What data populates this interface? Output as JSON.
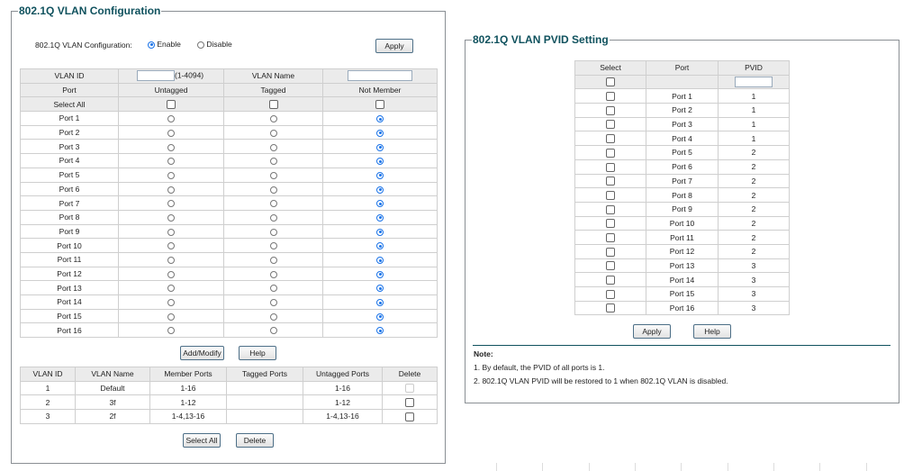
{
  "vlan_config": {
    "title": "802.1Q VLAN Configuration",
    "mode_label": "802.1Q VLAN Configuration:",
    "enable_label": "Enable",
    "disable_label": "Disable",
    "mode": "Enable",
    "apply_label": "Apply",
    "vlan_id_label": "VLAN ID",
    "vlan_id_value": "",
    "vlan_id_range": "(1-4094)",
    "vlan_name_label": "VLAN Name",
    "vlan_name_value": "",
    "columns": [
      "Port",
      "Untagged",
      "Tagged",
      "Not Member"
    ],
    "select_all_label": "Select All",
    "ports": [
      {
        "name": "Port 1",
        "membership": "Not Member"
      },
      {
        "name": "Port 2",
        "membership": "Not Member"
      },
      {
        "name": "Port 3",
        "membership": "Not Member"
      },
      {
        "name": "Port 4",
        "membership": "Not Member"
      },
      {
        "name": "Port 5",
        "membership": "Not Member"
      },
      {
        "name": "Port 6",
        "membership": "Not Member"
      },
      {
        "name": "Port 7",
        "membership": "Not Member"
      },
      {
        "name": "Port 8",
        "membership": "Not Member"
      },
      {
        "name": "Port 9",
        "membership": "Not Member"
      },
      {
        "name": "Port 10",
        "membership": "Not Member"
      },
      {
        "name": "Port 11",
        "membership": "Not Member"
      },
      {
        "name": "Port 12",
        "membership": "Not Member"
      },
      {
        "name": "Port 13",
        "membership": "Not Member"
      },
      {
        "name": "Port 14",
        "membership": "Not Member"
      },
      {
        "name": "Port 15",
        "membership": "Not Member"
      },
      {
        "name": "Port 16",
        "membership": "Not Member"
      }
    ],
    "add_modify_label": "Add/Modify",
    "help_label": "Help",
    "list_columns": [
      "VLAN ID",
      "VLAN Name",
      "Member Ports",
      "Tagged Ports",
      "Untagged Ports",
      "Delete"
    ],
    "vlans": [
      {
        "id": "1",
        "name": "Default",
        "member": "1-16",
        "tagged": "",
        "untagged": "1-16",
        "deletable": false
      },
      {
        "id": "2",
        "name": "3f",
        "member": "1-12",
        "tagged": "",
        "untagged": "1-12",
        "deletable": true
      },
      {
        "id": "3",
        "name": "2f",
        "member": "1-4,13-16",
        "tagged": "",
        "untagged": "1-4,13-16",
        "deletable": true
      }
    ],
    "select_all_button": "Select All",
    "delete_button": "Delete"
  },
  "pvid": {
    "title": "802.1Q VLAN PVID Setting",
    "columns": [
      "Select",
      "Port",
      "PVID"
    ],
    "pvid_input": "",
    "rows": [
      {
        "port": "Port 1",
        "pvid": "1"
      },
      {
        "port": "Port 2",
        "pvid": "1"
      },
      {
        "port": "Port 3",
        "pvid": "1"
      },
      {
        "port": "Port 4",
        "pvid": "1"
      },
      {
        "port": "Port 5",
        "pvid": "2"
      },
      {
        "port": "Port 6",
        "pvid": "2"
      },
      {
        "port": "Port 7",
        "pvid": "2"
      },
      {
        "port": "Port 8",
        "pvid": "2"
      },
      {
        "port": "Port 9",
        "pvid": "2"
      },
      {
        "port": "Port 10",
        "pvid": "2"
      },
      {
        "port": "Port 11",
        "pvid": "2"
      },
      {
        "port": "Port 12",
        "pvid": "2"
      },
      {
        "port": "Port 13",
        "pvid": "3"
      },
      {
        "port": "Port 14",
        "pvid": "3"
      },
      {
        "port": "Port 15",
        "pvid": "3"
      },
      {
        "port": "Port 16",
        "pvid": "3"
      }
    ],
    "apply_label": "Apply",
    "help_label": "Help",
    "note_title": "Note:",
    "notes": [
      "1. By default, the PVID of all ports is 1.",
      "2. 802.1Q VLAN PVID will be restored to 1 when 802.1Q VLAN is disabled."
    ]
  }
}
